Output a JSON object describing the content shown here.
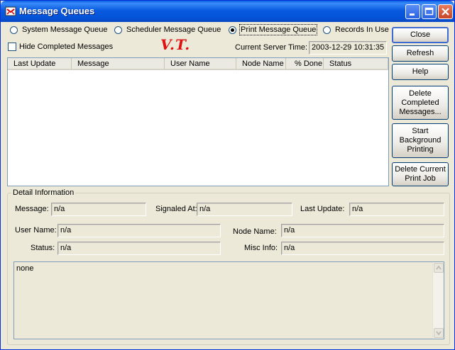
{
  "window": {
    "title": "Message Queues"
  },
  "queue_options": [
    {
      "label": "System Message Queue",
      "selected": false
    },
    {
      "label": "Scheduler Message Queue",
      "selected": false
    },
    {
      "label": "Print Message Queue",
      "selected": true
    },
    {
      "label": "Records In Use",
      "selected": false
    }
  ],
  "hide_completed": {
    "label": "Hide Completed Messages",
    "checked": false
  },
  "server_time": {
    "label": "Current Server Time:",
    "value": "2003-12-29 10:31:35"
  },
  "annotation": "V.T.",
  "table": {
    "columns": [
      "Last Update",
      "Message",
      "User Name",
      "Node Name",
      "% Done",
      "Status"
    ],
    "rows": []
  },
  "buttons": {
    "close": "Close",
    "refresh": "Refresh",
    "help": "Help",
    "delete_completed": [
      "Delete",
      "Completed",
      "Messages..."
    ],
    "start_background": [
      "Start",
      "Background",
      "Printing"
    ],
    "delete_current": [
      "Delete Current",
      "Print Job"
    ]
  },
  "detail": {
    "group_title": "Detail Information",
    "message_label": "Message:",
    "message_value": "n/a",
    "signaled_label": "Signaled At:",
    "signaled_value": "n/a",
    "last_update_label": "Last Update:",
    "last_update_value": "n/a",
    "user_label": "User Name:",
    "user_value": "n/a",
    "node_label": "Node Name:",
    "node_value": "n/a",
    "status_label": "Status:",
    "status_value": "n/a",
    "misc_label": "Misc Info:",
    "misc_value": "n/a",
    "memo": "none"
  },
  "icons": [
    "app-icon",
    "minimize-icon",
    "maximize-icon",
    "close-icon",
    "scroll-up-icon",
    "scroll-down-icon"
  ],
  "colors": {
    "titlebar": "#0A5BE0",
    "annotation": "#E01010",
    "face": "#ECE9D8"
  }
}
